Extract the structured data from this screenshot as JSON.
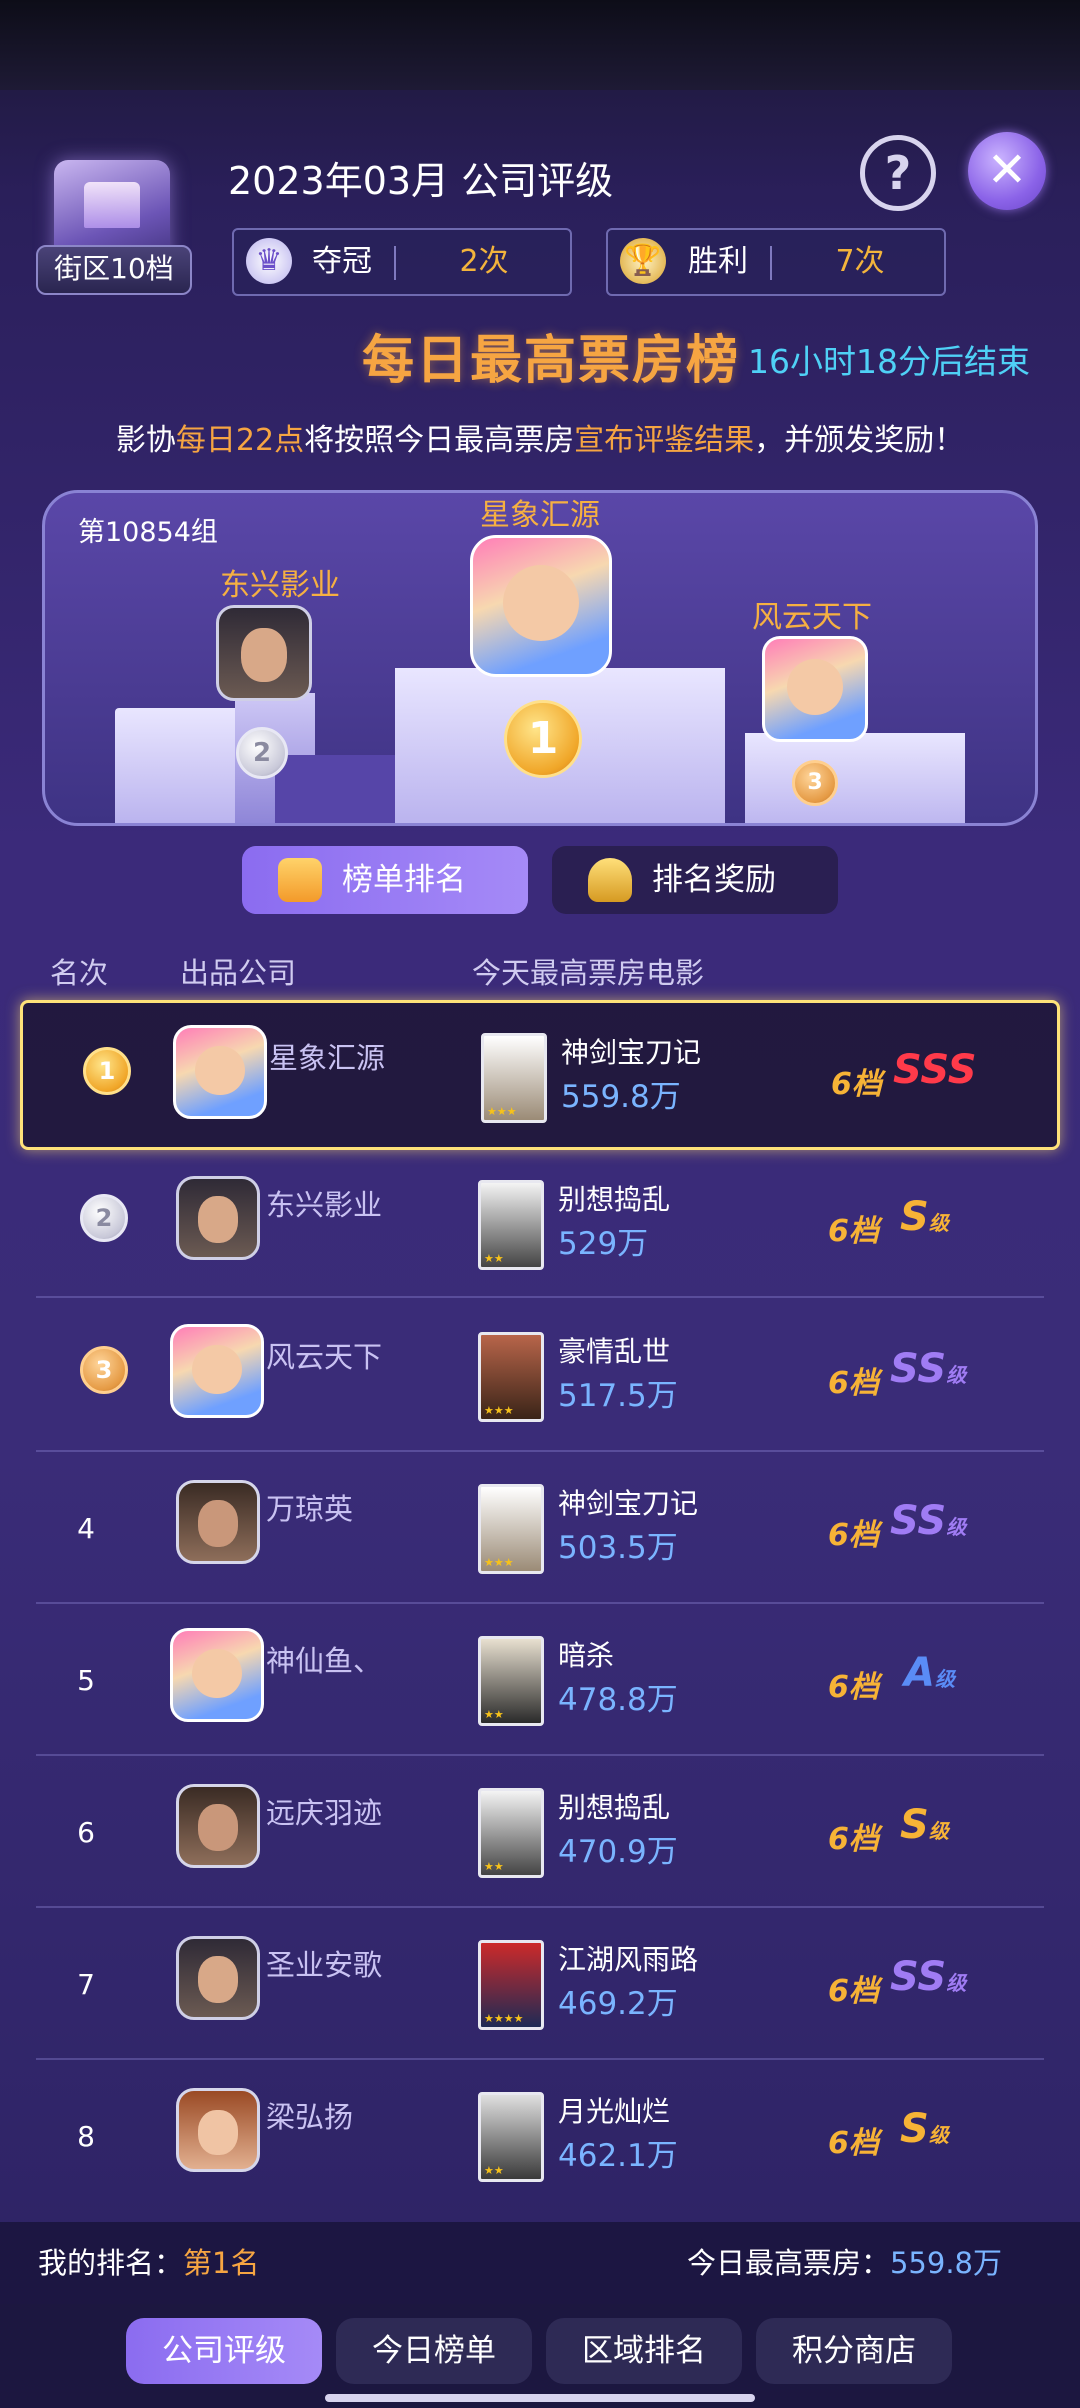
{
  "header": {
    "district_label": "街区10档",
    "title": "2023年03月 公司评级",
    "help_icon": "?",
    "close_icon": "✕",
    "stats": [
      {
        "icon": "crown-icon",
        "label": "夺冠",
        "value": "2次"
      },
      {
        "icon": "trophy-icon",
        "label": "胜利",
        "value": "7次"
      }
    ]
  },
  "board": {
    "title": "每日最高票房榜",
    "countdown": "16小时18分后结束",
    "notice_parts": [
      "影协",
      "每日22点",
      "将按照今日最高票房",
      "宣布评鉴结果",
      "，并颁发奖励！"
    ]
  },
  "podium": {
    "group": "第10854组",
    "first": "星象汇源",
    "second": "东兴影业",
    "third": "风云天下"
  },
  "tabs": [
    {
      "label": "榜单排名",
      "active": true
    },
    {
      "label": "排名奖励",
      "active": false
    }
  ],
  "columns": [
    "名次",
    "出品公司",
    "今天最高票房电影"
  ],
  "rows": [
    {
      "rank": "1",
      "company": "星象汇源",
      "movie": "神剑宝刀记",
      "box": "559.8万",
      "tier": "6档",
      "grade": "SSS",
      "grade_suffix": "",
      "stars": "★★★"
    },
    {
      "rank": "2",
      "company": "东兴影业",
      "movie": "别想捣乱",
      "box": "529万",
      "tier": "6档",
      "grade": "S",
      "grade_suffix": "级",
      "stars": "★★"
    },
    {
      "rank": "3",
      "company": "风云天下",
      "movie": "豪情乱世",
      "box": "517.5万",
      "tier": "6档",
      "grade": "SS",
      "grade_suffix": "级",
      "stars": "★★★"
    },
    {
      "rank": "4",
      "company": "万琼英",
      "movie": "神剑宝刀记",
      "box": "503.5万",
      "tier": "6档",
      "grade": "SS",
      "grade_suffix": "级",
      "stars": "★★★"
    },
    {
      "rank": "5",
      "company": "神仙鱼、",
      "movie": "暗杀",
      "box": "478.8万",
      "tier": "6档",
      "grade": "A",
      "grade_suffix": "级",
      "stars": "★★"
    },
    {
      "rank": "6",
      "company": "远庆羽迹",
      "movie": "别想捣乱",
      "box": "470.9万",
      "tier": "6档",
      "grade": "S",
      "grade_suffix": "级",
      "stars": "★★"
    },
    {
      "rank": "7",
      "company": "圣业安歌",
      "movie": "江湖风雨路",
      "box": "469.2万",
      "tier": "6档",
      "grade": "SS",
      "grade_suffix": "级",
      "stars": "★★★★"
    },
    {
      "rank": "8",
      "company": "梁弘扬",
      "movie": "月光灿烂",
      "box": "462.1万",
      "tier": "6档",
      "grade": "S",
      "grade_suffix": "级",
      "stars": "★★"
    }
  ],
  "footer": {
    "my_rank_label": "我的排名：",
    "my_rank_value": "第1名",
    "today_label": "今日最高票房：",
    "today_value": "559.8万"
  },
  "nav": [
    {
      "label": "公司评级",
      "active": true
    },
    {
      "label": "今日榜单",
      "active": false
    },
    {
      "label": "区域排名",
      "active": false
    },
    {
      "label": "积分商店",
      "active": false
    }
  ],
  "colors": {
    "gold": "#f6a542",
    "cyan": "#4fd1f6",
    "blue_value": "#7ab4ff",
    "purple_grade": "#a07cf4",
    "red_grade": "#ff3a4a"
  }
}
